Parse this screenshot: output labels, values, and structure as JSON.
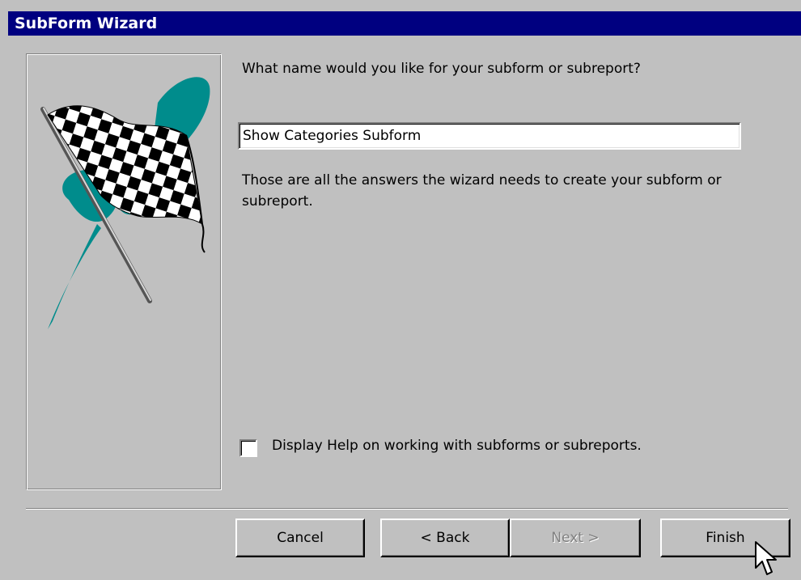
{
  "window": {
    "title": "SubForm Wizard"
  },
  "content": {
    "question": "What name would you like for your subform or subreport?",
    "name_value": "Show Categories Subform",
    "info": "Those are all the answers the wizard needs to create your subform or subreport.",
    "help_checkbox": {
      "label": "Display Help on working with subforms or subreports.",
      "checked": false
    }
  },
  "buttons": {
    "cancel": "Cancel",
    "back": "< Back",
    "next": "Next >",
    "finish": "Finish"
  },
  "icons": {
    "wizard_picture": "checkered-flag-icon",
    "cursor": "mouse-pointer-icon"
  },
  "colors": {
    "titlebar": "#000080",
    "face": "#c0c0c0",
    "teal_brush": "#008c8c"
  }
}
